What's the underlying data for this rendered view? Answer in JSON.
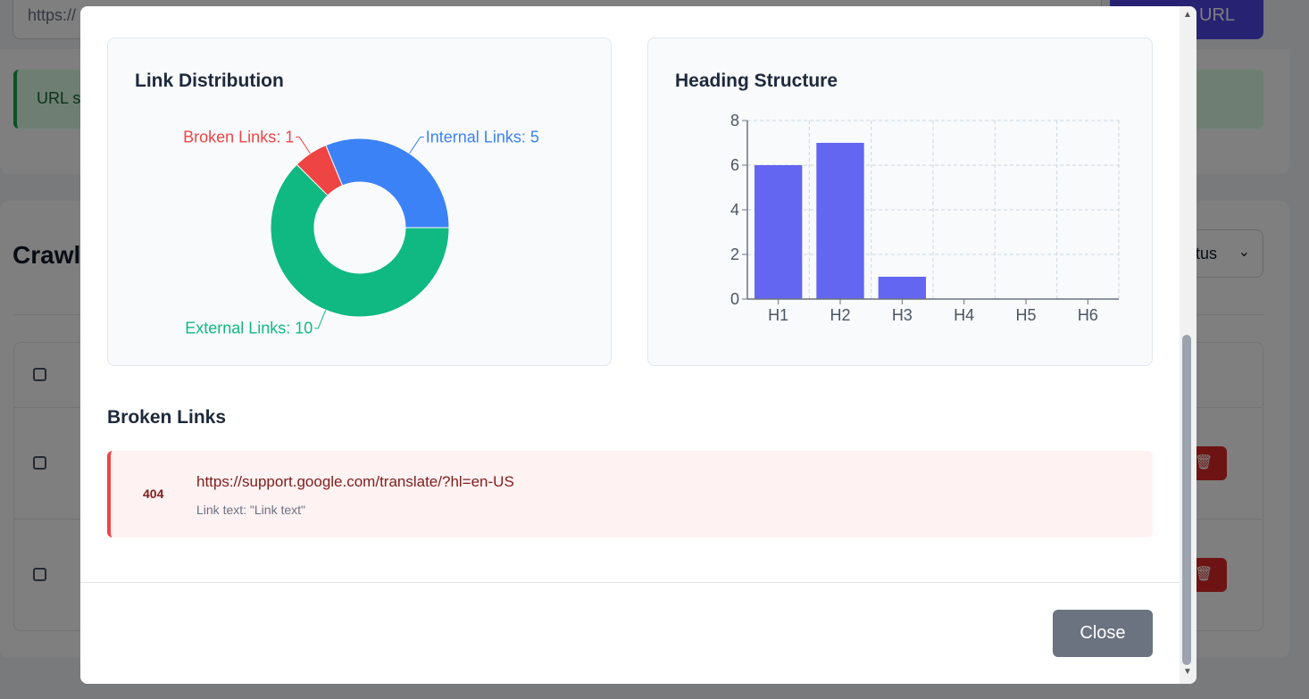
{
  "background": {
    "url_input_value": "https://",
    "add_button_label": "URL",
    "alert_text": "URL s",
    "crawl_heading": "Crawl",
    "status_select_value": "tus"
  },
  "modal": {
    "link_card_title": "Link Distribution",
    "heading_card_title": "Heading Structure",
    "broken_section_title": "Broken Links",
    "broken_links": [
      {
        "status_code": "404",
        "url": "https://support.google.com/translate/?hl=en-US",
        "link_text": "Link text: \"Link text\""
      }
    ],
    "close_label": "Close"
  },
  "chart_data": [
    {
      "type": "pie",
      "variant": "donut",
      "labels": [
        "Internal Links",
        "Broken Links",
        "External Links"
      ],
      "values": [
        5,
        1,
        10
      ],
      "label_texts": [
        "Internal Links: 5",
        "Broken Links: 1",
        "External Links: 10"
      ],
      "colors": [
        "#3b82f6",
        "#ef4444",
        "#10b981"
      ]
    },
    {
      "type": "bar",
      "categories": [
        "H1",
        "H2",
        "H3",
        "H4",
        "H5",
        "H6"
      ],
      "values": [
        6,
        7,
        1,
        0,
        0,
        0
      ],
      "ylim": [
        0,
        8
      ],
      "yticks": [
        0,
        2,
        4,
        6,
        8
      ],
      "grid": true,
      "color": "#6366f1"
    }
  ]
}
